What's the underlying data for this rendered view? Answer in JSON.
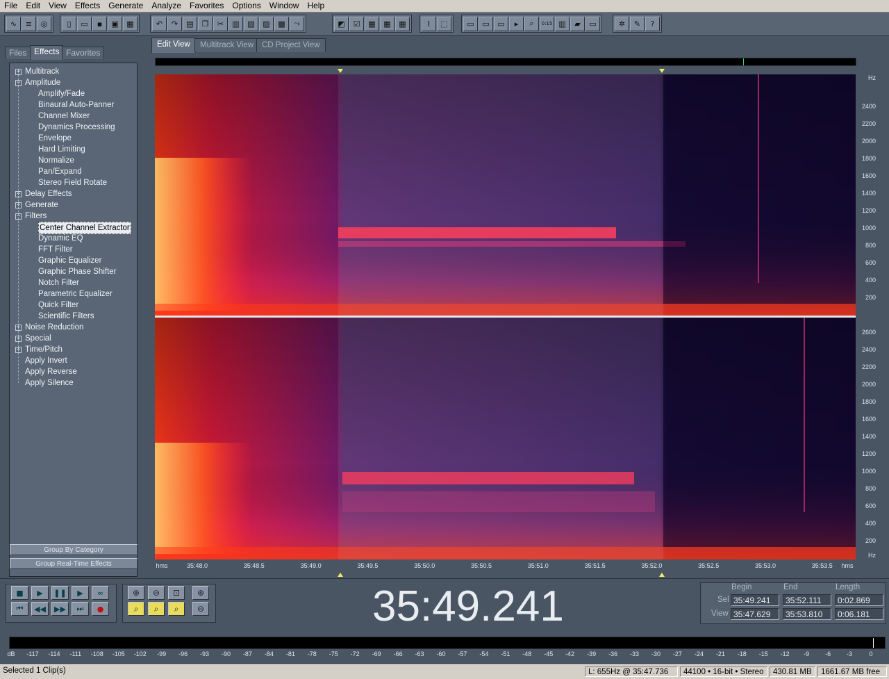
{
  "menu": [
    "File",
    "Edit",
    "View",
    "Effects",
    "Generate",
    "Analyze",
    "Favorites",
    "Options",
    "Window",
    "Help"
  ],
  "toolbar": {
    "groups": [
      [
        "waveform-view-icon",
        "multitrack-icon",
        "cd-icon"
      ],
      [
        "new-file-icon",
        "open-icon",
        "save-icon",
        "save-all-icon",
        "close-icon"
      ],
      [
        "undo-icon",
        "redo-icon",
        "copy-new-icon",
        "copy-icon",
        "cut-icon",
        "paste-icon",
        "paste-new-icon",
        "mix-paste-icon",
        "trim-icon",
        "snap-icon"
      ],
      [
        "spectral-view-icon",
        "check-icon",
        "grid-icon",
        "grid2-icon",
        "grid3-icon"
      ],
      [
        "time-select-icon",
        "marquee-icon"
      ],
      [
        "view1-icon",
        "view2-icon",
        "view3-icon",
        "play-icon",
        "zoom-icon",
        "time-format-icon",
        "bars-icon",
        "color-icon",
        "spacer-icon"
      ],
      [
        "settings-icon",
        "tools-icon",
        "help-icon"
      ]
    ]
  },
  "left_tabs": [
    "Files",
    "Effects",
    "Favorites"
  ],
  "tree": [
    {
      "label": "Multitrack",
      "level": 0,
      "exp": "+"
    },
    {
      "label": "Amplitude",
      "level": 0,
      "exp": "-"
    },
    {
      "label": "Amplify/Fade",
      "level": 1
    },
    {
      "label": "Binaural Auto-Panner",
      "level": 1
    },
    {
      "label": "Channel Mixer",
      "level": 1
    },
    {
      "label": "Dynamics Processing",
      "level": 1
    },
    {
      "label": "Envelope",
      "level": 1
    },
    {
      "label": "Hard Limiting",
      "level": 1
    },
    {
      "label": "Normalize",
      "level": 1
    },
    {
      "label": "Pan/Expand",
      "level": 1
    },
    {
      "label": "Stereo Field Rotate",
      "level": 1
    },
    {
      "label": "Delay Effects",
      "level": 0,
      "exp": "+"
    },
    {
      "label": "Generate",
      "level": 0,
      "exp": "+"
    },
    {
      "label": "Filters",
      "level": 0,
      "exp": "-"
    },
    {
      "label": "Center Channel Extractor",
      "level": 1,
      "selected": true
    },
    {
      "label": "Dynamic EQ",
      "level": 1
    },
    {
      "label": "FFT Filter",
      "level": 1
    },
    {
      "label": "Graphic Equalizer",
      "level": 1
    },
    {
      "label": "Graphic Phase Shifter",
      "level": 1
    },
    {
      "label": "Notch Filter",
      "level": 1
    },
    {
      "label": "Parametric Equalizer",
      "level": 1
    },
    {
      "label": "Quick Filter",
      "level": 1
    },
    {
      "label": "Scientific Filters",
      "level": 1
    },
    {
      "label": "Noise Reduction",
      "level": 0,
      "exp": "+"
    },
    {
      "label": "Special",
      "level": 0,
      "exp": "+"
    },
    {
      "label": "Time/Pitch",
      "level": 0,
      "exp": "+"
    },
    {
      "label": "Apply Invert",
      "level": 0
    },
    {
      "label": "Apply Reverse",
      "level": 0
    },
    {
      "label": "Apply Silence",
      "level": 0
    }
  ],
  "left_buttons": {
    "group_by_category": "Group By Category",
    "group_realtime": "Group Real-Time Effects"
  },
  "view_tabs": [
    "Edit View",
    "Multitrack View",
    "CD Project View"
  ],
  "ruler_unit": "hms",
  "ruler_ticks": [
    "35:48.0",
    "35:48.5",
    "35:49.0",
    "35:49.5",
    "35:50.0",
    "35:50.5",
    "35:51.0",
    "35:51.5",
    "35:52.0",
    "35:52.5",
    "35:53.0",
    "35:53.5"
  ],
  "ruler_unit_right": "hms",
  "hz_unit": "Hz",
  "hz_top": [
    "2400",
    "2200",
    "2000",
    "1800",
    "1600",
    "1400",
    "1200",
    "1000",
    "800",
    "600",
    "400",
    "200"
  ],
  "hz_bottom": [
    "2600",
    "2400",
    "2200",
    "2000",
    "1800",
    "1600",
    "1400",
    "1200",
    "1000",
    "800",
    "600",
    "400",
    "200"
  ],
  "transport": [
    "stop-icon",
    "play-icon",
    "pause-icon",
    "play-to-end-icon",
    "loop-icon",
    "go-to-start-icon",
    "rewind-icon",
    "fast-forward-icon",
    "go-to-end-icon",
    "record-icon"
  ],
  "zoom": [
    "zoom-in-h-icon",
    "zoom-out-h-icon",
    "zoom-full-icon",
    "zoom-in-v-icon",
    "zoom-left-icon",
    "zoom-right-icon",
    "zoom-selection-icon",
    "zoom-out-v-icon"
  ],
  "time_display": "35:49.241",
  "selection": {
    "headers": [
      "Begin",
      "End",
      "Length"
    ],
    "sel_label": "Sel",
    "view_label": "View",
    "sel": [
      "35:49.241",
      "35:52.111",
      "0:02.869"
    ],
    "view": [
      "35:47.629",
      "35:53.810",
      "0:06.181"
    ]
  },
  "meter_ticks": [
    "dB",
    "-117",
    "-114",
    "-111",
    "-108",
    "-105",
    "-102",
    "-99",
    "-96",
    "-93",
    "-90",
    "-87",
    "-84",
    "-81",
    "-78",
    "-75",
    "-72",
    "-69",
    "-66",
    "-63",
    "-60",
    "-57",
    "-54",
    "-51",
    "-48",
    "-45",
    "-42",
    "-39",
    "-36",
    "-33",
    "-30",
    "-27",
    "-24",
    "-21",
    "-18",
    "-15",
    "-12",
    "-9",
    "-6",
    "-3",
    "0"
  ],
  "status": {
    "left": "Selected 1 Clip(s)",
    "cursor": "L: 655Hz @  35:47.736",
    "format": "44100 • 16-bit • Stereo",
    "size": "430.81 MB",
    "free": "1661.67 MB free"
  }
}
